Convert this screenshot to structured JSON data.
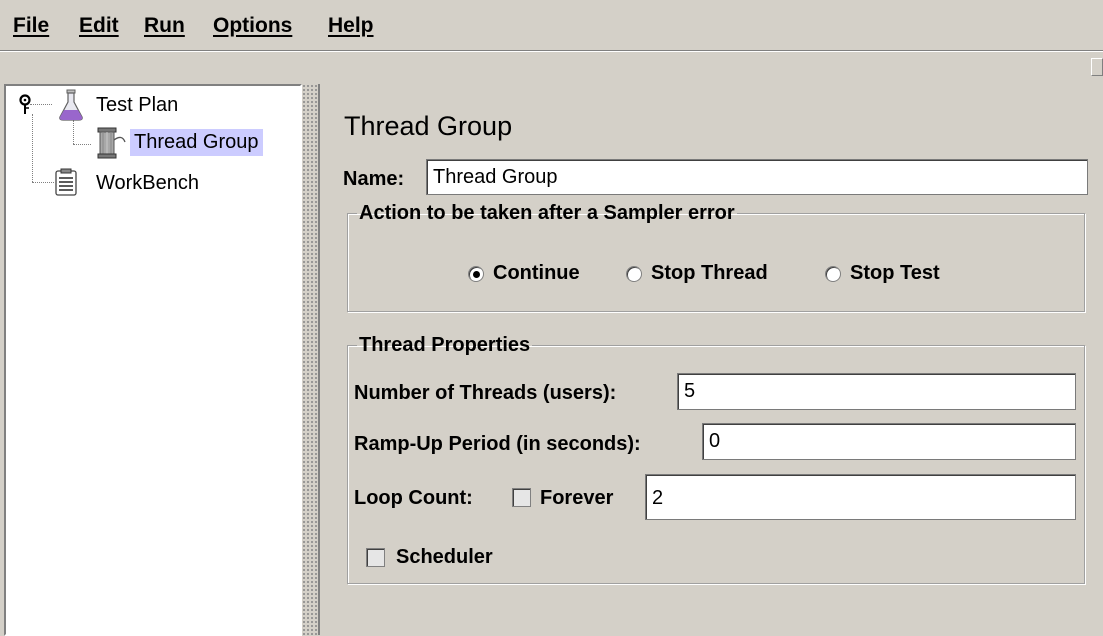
{
  "menu": [
    "File",
    "Edit",
    "Run",
    "Options",
    "Help"
  ],
  "tree": {
    "test_plan": "Test Plan",
    "thread_group": "Thread Group",
    "workbench": "WorkBench"
  },
  "panel": {
    "title": "Thread Group",
    "name_label": "Name:",
    "name_value": "Thread Group",
    "error_action": {
      "legend": "Action to be taken after a Sampler error",
      "options": [
        "Continue",
        "Stop Thread",
        "Stop Test"
      ],
      "selected": "Continue"
    },
    "thread_props": {
      "legend": "Thread Properties",
      "threads_label": "Number of Threads (users):",
      "threads_value": "5",
      "rampup_label": "Ramp-Up Period (in seconds):",
      "rampup_value": "0",
      "loop_label": "Loop Count:",
      "forever_label": "Forever",
      "forever_checked": false,
      "loop_value": "2",
      "scheduler_label": "Scheduler",
      "scheduler_checked": false
    }
  },
  "colors": {
    "background": "#d4d0c8",
    "selection": "#ccccff",
    "field_bg": "#ffffff"
  }
}
